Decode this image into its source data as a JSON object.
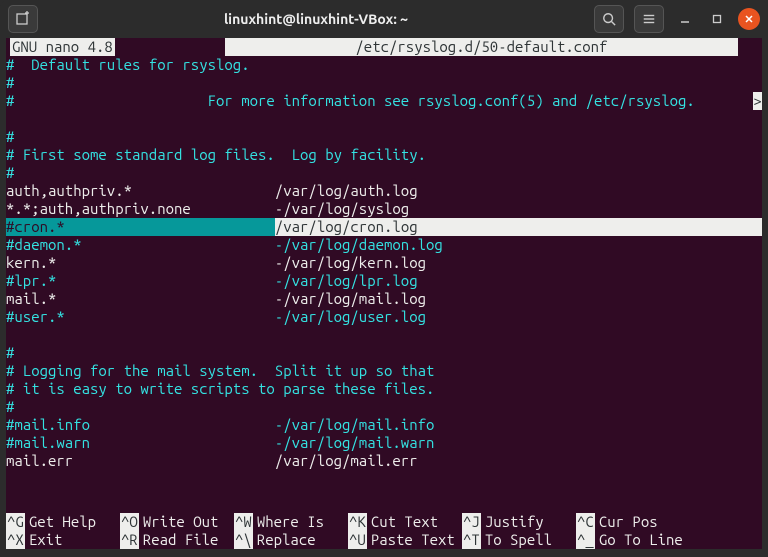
{
  "titlebar": {
    "title": "linuxhint@linuxhint-VBox: ~"
  },
  "editor": {
    "app": "  GNU nano 4.8",
    "file": "/etc/rsyslog.d/50-default.conf",
    "lines": [
      {
        "cls": "comment",
        "text": "#  Default rules for rsyslog."
      },
      {
        "cls": "comment",
        "text": "#"
      },
      {
        "cls": "comment",
        "text": "#                       For more information see rsyslog.conf(5) and /etc/rsyslog.",
        "cont": ">"
      },
      {
        "cls": "blank",
        "text": ""
      },
      {
        "cls": "comment",
        "text": "#"
      },
      {
        "cls": "comment",
        "text": "# First some standard log files.  Log by facility."
      },
      {
        "cls": "comment",
        "text": "#"
      },
      {
        "cls": "white",
        "text": "auth,authpriv.*                 /var/log/auth.log"
      },
      {
        "cls": "white",
        "text": "*.*;auth,authpriv.none          -/var/log/syslog"
      },
      {
        "cls": "hl",
        "part1": "#cron.*                         ",
        "part2": "/var/log/cron.log"
      },
      {
        "cls": "comment",
        "text": "#daemon.*                       -/var/log/daemon.log"
      },
      {
        "cls": "white",
        "text": "kern.*                          -/var/log/kern.log"
      },
      {
        "cls": "comment",
        "text": "#lpr.*                          -/var/log/lpr.log"
      },
      {
        "cls": "white",
        "text": "mail.*                          -/var/log/mail.log"
      },
      {
        "cls": "comment",
        "text": "#user.*                         -/var/log/user.log"
      },
      {
        "cls": "blank",
        "text": ""
      },
      {
        "cls": "comment",
        "text": "#"
      },
      {
        "cls": "comment",
        "text": "# Logging for the mail system.  Split it up so that"
      },
      {
        "cls": "comment",
        "text": "# it is easy to write scripts to parse these files."
      },
      {
        "cls": "comment",
        "text": "#"
      },
      {
        "cls": "comment",
        "text": "#mail.info                      -/var/log/mail.info"
      },
      {
        "cls": "comment",
        "text": "#mail.warn                      -/var/log/mail.warn"
      },
      {
        "cls": "white",
        "text": "mail.err                        /var/log/mail.err"
      }
    ]
  },
  "shortcuts": {
    "row1": [
      {
        "key": "^G",
        "label": "Get Help"
      },
      {
        "key": "^O",
        "label": "Write Out"
      },
      {
        "key": "^W",
        "label": "Where Is"
      },
      {
        "key": "^K",
        "label": "Cut Text"
      },
      {
        "key": "^J",
        "label": "Justify"
      },
      {
        "key": "^C",
        "label": "Cur Pos"
      }
    ],
    "row2": [
      {
        "key": "^X",
        "label": "Exit"
      },
      {
        "key": "^R",
        "label": "Read File"
      },
      {
        "key": "^\\",
        "label": "Replace"
      },
      {
        "key": "^U",
        "label": "Paste Text"
      },
      {
        "key": "^T",
        "label": "To Spell"
      },
      {
        "key": "^_",
        "label": "Go To Line"
      }
    ]
  }
}
